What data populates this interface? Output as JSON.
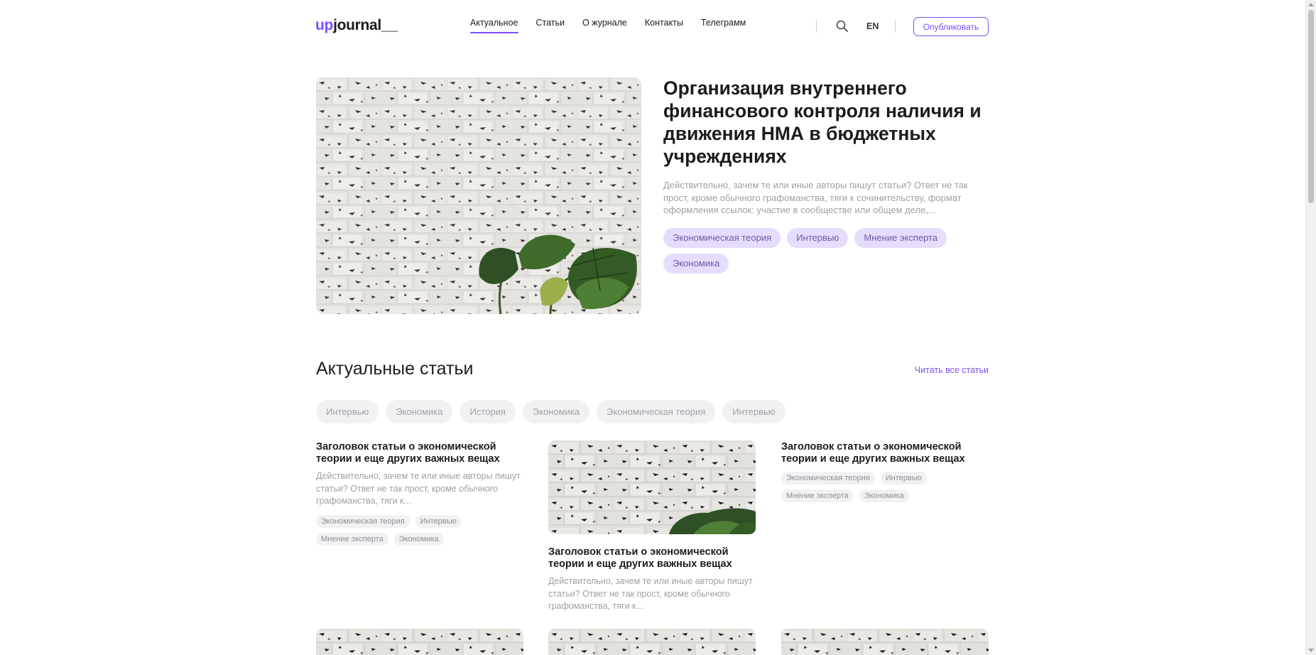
{
  "header": {
    "logo_accent": "up",
    "logo_main": "journal__",
    "nav": [
      {
        "label": "Актуальное",
        "active": true
      },
      {
        "label": "Статьи",
        "active": false
      },
      {
        "label": "О журнале",
        "active": false
      },
      {
        "label": "Контакты",
        "active": false
      },
      {
        "label": "Телеграмм",
        "active": false
      }
    ],
    "search_icon": "search-icon",
    "lang": "EN",
    "publish_label": "Опубликовать"
  },
  "hero": {
    "title": "Организация внутреннего финансового контроля наличия и движения НМА в бюджетных учреждениях",
    "description": "Действительно, зачем те или иные авторы пишут статьи? Ответ не так прост, кроме обычного графоманства, тяги к сочинительству, формат оформления ссылок: участие в сообществе или общем деле,...",
    "tags": [
      "Экономическая теория",
      "Интервью",
      "Мнение эксперта",
      "Экономика"
    ]
  },
  "section": {
    "title": "Актуальные статьи",
    "read_all": "Читать все статьи",
    "filters": [
      "Интервью",
      "Экономика",
      "История",
      "Экономика",
      "Экономическая теория",
      "Интервью"
    ]
  },
  "cards": [
    {
      "title": "Заголовок статьи о экономической теории и еще других важных вещах",
      "description": "Действительно, зачем те или иные авторы пишут статьи? Ответ не так прост, кроме обычного графоманства, тяги к...",
      "tags": [
        "Экономическая теория",
        "Интервью",
        "Мнение эксперта",
        "Экономика"
      ]
    },
    {
      "title": "Заголовок статьи о экономической теории и еще других важных вещах",
      "description": "Действительно, зачем те или иные авторы пишут статьи? Ответ не так прост, кроме обычного графоманства, тяги к..."
    },
    {
      "title": "Заголовок статьи о экономической теории и еще других важных вещах",
      "tags": [
        "Экономическая теория",
        "Интервью",
        "Мнение эксперта",
        "Экономика"
      ]
    }
  ],
  "colors": {
    "accent": "#7c4dff",
    "tag_lavender": "#e6dcfd",
    "tag_gray": "#f1f1f3",
    "muted_text": "#a0a0a5"
  }
}
